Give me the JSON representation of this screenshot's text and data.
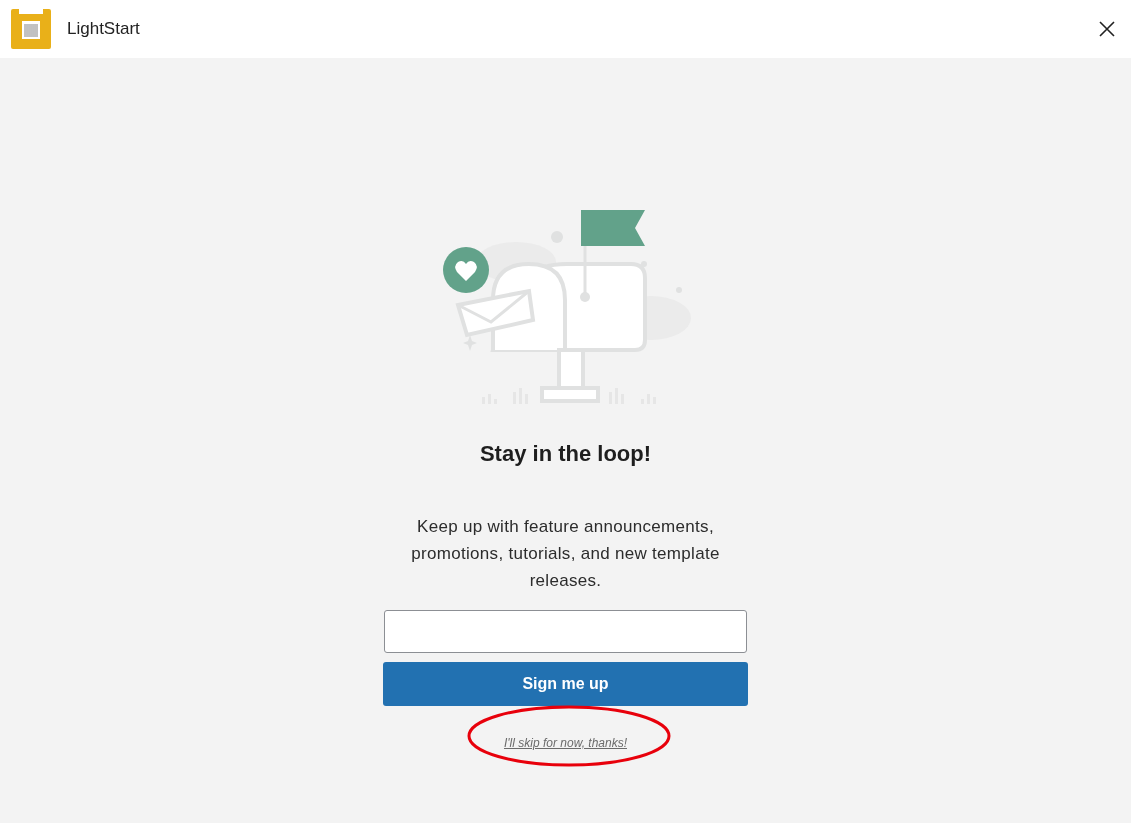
{
  "window": {
    "title": "LightStart"
  },
  "heading": "Stay in the loop!",
  "description": "Keep up with feature announcements, promotions, tutorials, and new template releases.",
  "signup_button": "Sign me up",
  "skip_link": "I'll skip for now, thanks!"
}
